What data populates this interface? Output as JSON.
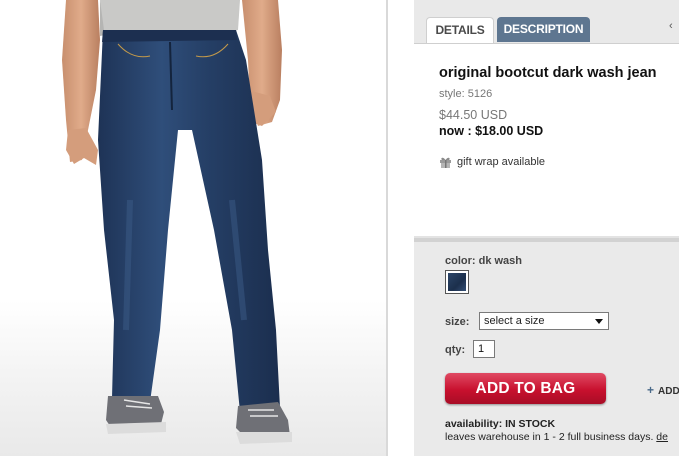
{
  "tabs": {
    "details": "DETAILS",
    "description": "DESCRIPTION",
    "more_arrow": "‹"
  },
  "product": {
    "title": "original bootcut dark wash jean",
    "style": "style: 5126",
    "original_price": "$44.50 USD",
    "now_price": "now : $18.00 USD",
    "gift_wrap": "gift wrap available"
  },
  "options": {
    "color_label": "color: dk wash",
    "swatch_color": "#263d5f",
    "size_label": "size:",
    "size_selected": "select a size",
    "qty_label": "qty:",
    "qty_value": "1"
  },
  "actions": {
    "add_to_bag": "ADD TO BAG",
    "add_more": "ADD"
  },
  "availability": {
    "label": "availability:",
    "status": "IN STOCK",
    "leaves": "leaves warehouse in 1 - 2 full business days.",
    "details_link": "de"
  },
  "colors": {
    "tab_active_bg": "#5e7690",
    "button_red": "#c8102e",
    "panel_bg": "#e3e3e3"
  }
}
